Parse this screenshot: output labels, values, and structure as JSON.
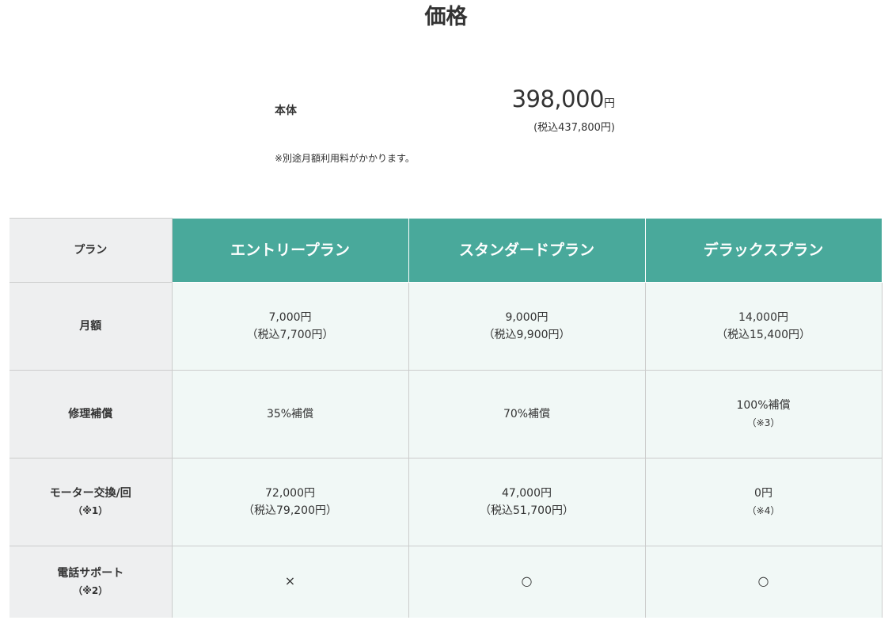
{
  "page": {
    "title": "価格"
  },
  "price": {
    "label": "本体",
    "value": "398,000",
    "unit": "円",
    "tax_included": "(税込437,800円)",
    "note": "※別途月額利用料がかかります。"
  },
  "table": {
    "corner_label": "プラン",
    "plans": [
      {
        "name": "エントリープラン"
      },
      {
        "name": "スタンダードプラン"
      },
      {
        "name": "デラックスプラン"
      }
    ],
    "rows": [
      {
        "label": "月額",
        "sub": "",
        "cells": [
          {
            "line1": "7,000円",
            "line2": "（税込7,700円）",
            "note": ""
          },
          {
            "line1": "9,000円",
            "line2": "（税込9,900円）",
            "note": ""
          },
          {
            "line1": "14,000円",
            "line2": "（税込15,400円）",
            "note": ""
          }
        ]
      },
      {
        "label": "修理補償",
        "sub": "",
        "cells": [
          {
            "line1": "35%補償",
            "line2": "",
            "note": ""
          },
          {
            "line1": "70%補償",
            "line2": "",
            "note": ""
          },
          {
            "line1": "100%補償",
            "line2": "",
            "note": "（※3）"
          }
        ]
      },
      {
        "label": "モーター交換/回",
        "sub": "（※1）",
        "cells": [
          {
            "line1": "72,000円",
            "line2": "（税込79,200円）",
            "note": ""
          },
          {
            "line1": "47,000円",
            "line2": "（税込51,700円）",
            "note": ""
          },
          {
            "line1": "0円",
            "line2": "",
            "note": "（※4）"
          }
        ]
      },
      {
        "label": "電話サポート",
        "sub": "（※2）",
        "cells": [
          {
            "line1": "×",
            "line2": "",
            "note": ""
          },
          {
            "line1": "○",
            "line2": "",
            "note": ""
          },
          {
            "line1": "○",
            "line2": "",
            "note": ""
          }
        ]
      }
    ]
  }
}
